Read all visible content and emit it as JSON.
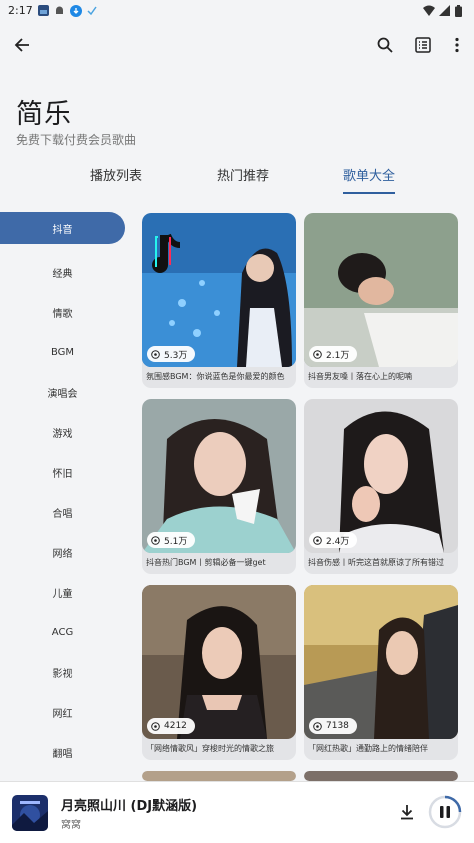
{
  "status_bar": {
    "time": "2:17"
  },
  "toolbar": {
    "back_icon": "arrow-left-icon",
    "search_icon": "search-icon",
    "list_icon": "list-box-icon",
    "more_icon": "more-vertical-icon"
  },
  "header": {
    "title": "简乐",
    "subtitle": "免费下载付费会员歌曲"
  },
  "tabs": [
    {
      "label": "播放列表",
      "active": false
    },
    {
      "label": "热门推荐",
      "active": false
    },
    {
      "label": "歌单大全",
      "active": true
    }
  ],
  "sidebar": {
    "items": [
      {
        "label": "抖音",
        "active": true
      },
      {
        "label": "经典"
      },
      {
        "label": "情歌"
      },
      {
        "label": "BGM"
      },
      {
        "label": "演唱会"
      },
      {
        "label": "游戏"
      },
      {
        "label": "怀旧"
      },
      {
        "label": "合唱"
      },
      {
        "label": "网络"
      },
      {
        "label": "儿童"
      },
      {
        "label": "ACG"
      },
      {
        "label": "影视"
      },
      {
        "label": "网红"
      },
      {
        "label": "翻唱"
      }
    ]
  },
  "playlists": [
    {
      "count": "5.3万",
      "title": "氛围感BGM：你说蓝色是你最爱的颜色"
    },
    {
      "count": "2.1万",
      "title": "抖音男友嗓丨落在心上的呢喃"
    },
    {
      "count": "5.1万",
      "title": "抖音热门BGM丨剪辑必备一键get"
    },
    {
      "count": "2.4万",
      "title": "抖音伤感丨听完这首就原谅了所有错过"
    },
    {
      "count": "4212",
      "title": "「网络情歌风」穿梭时光的情歌之旅"
    },
    {
      "count": "7138",
      "title": "「网红热歌」通勤路上的情绪陪伴"
    }
  ],
  "player": {
    "title": "月亮照山川 (DJ默涵版)",
    "artist": "窝窝",
    "download_icon": "download-icon",
    "pause_icon": "pause-icon"
  },
  "colors": {
    "accent": "#3f6aa8",
    "background": "#f3f4f6",
    "card": "#e3e4e7"
  }
}
